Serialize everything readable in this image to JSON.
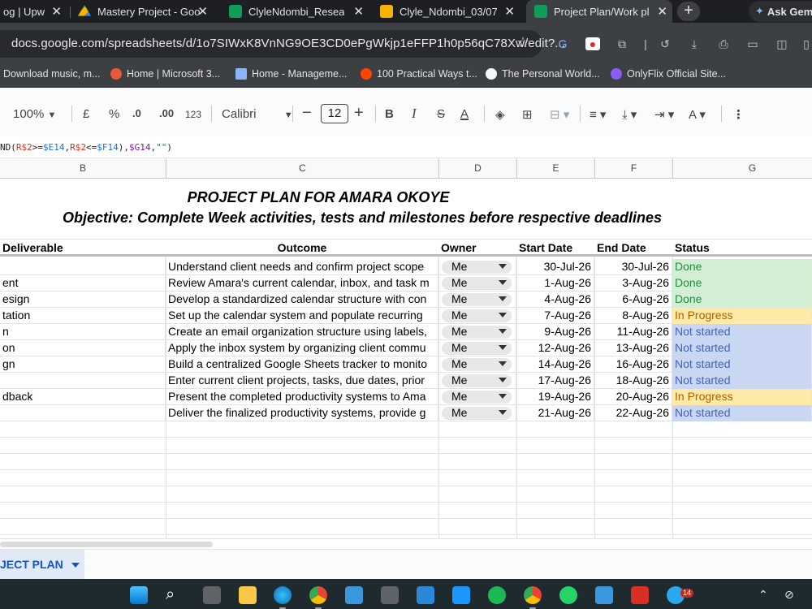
{
  "browser": {
    "tabs": [
      {
        "title": "og | Upw",
        "fav_color": "#1e1f22"
      },
      {
        "title": "Mastery Project - Goo",
        "fav_color": "#1a73e8"
      },
      {
        "title": "ClyleNdombi_Researc",
        "fav_color": "#0f9d58"
      },
      {
        "title": "Clyle_Ndombi_03/07/",
        "fav_color": "#f4b400"
      },
      {
        "title": "Project Plan/Work pla",
        "fav_color": "#0f9d58"
      }
    ],
    "ask_gemini": "Ask Gem",
    "url": "docs.google.com/spreadsheets/d/1o7SIWxK8VnNG9OE3CD0ePgWkjp1eFFP1h0p56qC78Xw/edit?...",
    "bookmarks": [
      {
        "label": "Download music, m...",
        "color": "#3c4043"
      },
      {
        "label": "Home | Microsoft 3...",
        "color": "#e85a3a"
      },
      {
        "label": "Home - Manageme...",
        "color": "#8ab4f8"
      },
      {
        "label": "100 Practical Ways t...",
        "color": "#ff4500"
      },
      {
        "label": "The Personal World...",
        "color": "#f5f5f5"
      },
      {
        "label": "OnlyFlix Official Site...",
        "color": "#8b5cf6"
      }
    ]
  },
  "sheets_toolbar": {
    "zoom": "100%",
    "currency": "£",
    "percent": "%",
    "dec_decrease": ".0",
    "dec_increase": ".00",
    "number_format": "123",
    "font": "Calibri",
    "font_size": "12",
    "bold": "B",
    "italic": "I",
    "strike": "S",
    "text_color": "A"
  },
  "formula_bar": {
    "p1": "ND(",
    "p2": "R$2",
    "p3": ">=",
    "p4": "$E14",
    "p5": ",",
    "p6": "R$2",
    "p7": "<=",
    "p8": "$F14",
    "p9": "),",
    "p10": "$G14",
    "p11": ",",
    "p12": "\"\"",
    "p13": ")"
  },
  "columns": [
    "B",
    "C",
    "D",
    "E",
    "F",
    "G"
  ],
  "sheet": {
    "title": "PROJECT PLAN FOR AMARA OKOYE",
    "objective": "Objective: Complete Week  activities, tests and milestones before respective deadlines",
    "headers": {
      "deliverable": "Deliverable",
      "outcome": "Outcome",
      "owner": "Owner",
      "start": "Start Date",
      "end": "End Date",
      "status": "Status"
    },
    "rows": [
      {
        "deliverable": "",
        "outcome": "Understand client needs and confirm project scope",
        "owner": "Me",
        "start": "30-Jul-26",
        "end": "30-Jul-26",
        "status": "Done"
      },
      {
        "deliverable": "ent",
        "outcome": "Review Amara's current calendar, inbox, and task m",
        "owner": "Me",
        "start": "1-Aug-26",
        "end": "3-Aug-26",
        "status": "Done"
      },
      {
        "deliverable": "esign",
        "outcome": "Develop a standardized calendar structure with con",
        "owner": "Me",
        "start": "4-Aug-26",
        "end": "6-Aug-26",
        "status": "Done"
      },
      {
        "deliverable": "tation",
        "outcome": "Set up the calendar system and populate recurring",
        "owner": "Me",
        "start": "7-Aug-26",
        "end": "8-Aug-26",
        "status": "In Progress"
      },
      {
        "deliverable": "n",
        "outcome": "Create an email organization structure using labels,",
        "owner": "Me",
        "start": "9-Aug-26",
        "end": "11-Aug-26",
        "status": "Not started"
      },
      {
        "deliverable": "on",
        "outcome": "Apply the inbox system by organizing client commu",
        "owner": "Me",
        "start": "12-Aug-26",
        "end": "13-Aug-26",
        "status": "Not started"
      },
      {
        "deliverable": "gn",
        "outcome": "Build a centralized Google Sheets tracker to monito",
        "owner": "Me",
        "start": "14-Aug-26",
        "end": "16-Aug-26",
        "status": "Not started"
      },
      {
        "deliverable": "",
        "outcome": "Enter current client projects, tasks, due dates, prior",
        "owner": "Me",
        "start": "17-Aug-26",
        "end": "18-Aug-26",
        "status": "Not started"
      },
      {
        "deliverable": "dback",
        "outcome": "Present the completed productivity systems to Ama",
        "owner": "Me",
        "start": "19-Aug-26",
        "end": "20-Aug-26",
        "status": "In Progress"
      },
      {
        "deliverable": "",
        "outcome": "Deliver the finalized productivity systems, provide g",
        "owner": "Me",
        "start": "21-Aug-26",
        "end": "22-Aug-26",
        "status": "Not started"
      }
    ],
    "status_colors": {
      "Done": {
        "bg": "#d4edd5",
        "fg": "#1e8e3e"
      },
      "In Progress": {
        "bg": "#fde9a8",
        "fg": "#b06000"
      },
      "Not started": {
        "bg": "#c9d7f2",
        "fg": "#3f63b8"
      }
    }
  },
  "sheet_tab": "JECT PLAN"
}
